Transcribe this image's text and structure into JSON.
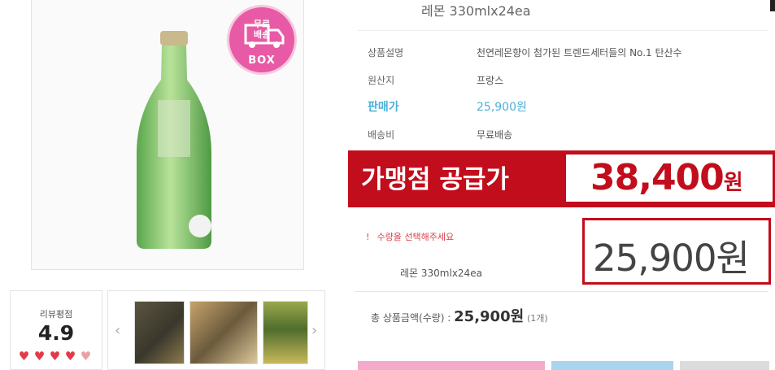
{
  "product": {
    "name": "레몬 330mlx24ea",
    "option_name": "레몬 330mlx24ea"
  },
  "badge": {
    "line1": "무료",
    "line2": "배송",
    "box_word": "BOX",
    "color": "#e85aa6"
  },
  "details": {
    "desc_label": "상품설명",
    "desc_value": "천연레몬향이 첨가된 트렌드세터들의 No.1 탄산수",
    "origin_label": "원산지",
    "origin_value": "프랑스",
    "price_label": "판매가",
    "price_value": "25,900원",
    "shipping_label": "배송비",
    "shipping_value": "무료배송"
  },
  "franchise": {
    "label": "가맹점 공급가",
    "price": "38,400",
    "unit": "원",
    "color": "#c20d1c"
  },
  "selection": {
    "note_icon": "!",
    "note": "수량을 선택해주세요",
    "price": "25,900원"
  },
  "total": {
    "label": "총 상품금액(수량) : ",
    "amount": "25,900원",
    "count": "(1개)"
  },
  "review": {
    "title": "리뷰평점",
    "score": "4.9",
    "stars_filled": 4.5,
    "stars_max": 5
  },
  "thumbnails": {
    "prev_icon": "chevron-left-icon",
    "next_icon": "chevron-right-icon"
  }
}
